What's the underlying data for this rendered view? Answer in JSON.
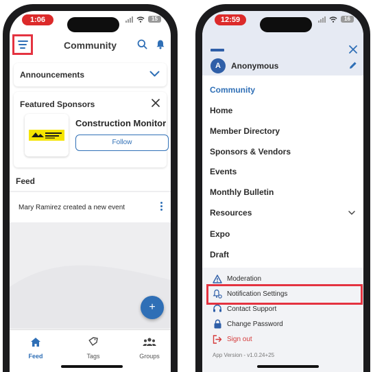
{
  "left_phone": {
    "status": {
      "time": "1:06",
      "battery": "15"
    },
    "header": {
      "title": "Community"
    },
    "announcements": {
      "label": "Announcements"
    },
    "featured_sponsors": {
      "label": "Featured Sponsors",
      "sponsor_name": "Construction Monitor",
      "logo_text": "CONSTRUCTION MONITOR",
      "follow_label": "Follow"
    },
    "feed": {
      "label": "Feed",
      "items": [
        {
          "text": "Mary Ramirez created a new event"
        }
      ]
    },
    "fab_label": "+",
    "tabs": [
      {
        "label": "Feed",
        "icon": "home-icon",
        "active": true
      },
      {
        "label": "Tags",
        "icon": "tag-icon",
        "active": false
      },
      {
        "label": "Groups",
        "icon": "groups-icon",
        "active": false
      }
    ]
  },
  "right_phone": {
    "status": {
      "time": "12:59",
      "battery": "16"
    },
    "user": {
      "initial": "A",
      "name": "Anonymous"
    },
    "nav": [
      {
        "label": "Community",
        "active": true
      },
      {
        "label": "Home"
      },
      {
        "label": "Member Directory"
      },
      {
        "label": "Sponsors & Vendors"
      },
      {
        "label": "Events"
      },
      {
        "label": "Monthly Bulletin"
      },
      {
        "label": "Resources",
        "has_chevron": true
      },
      {
        "label": "Expo"
      },
      {
        "label": "Draft"
      }
    ],
    "panel": [
      {
        "label": "Moderation",
        "icon": "warning-icon"
      },
      {
        "label": "Notification Settings",
        "icon": "bell-settings-icon",
        "highlighted": true
      },
      {
        "label": "Contact Support",
        "icon": "headset-icon"
      },
      {
        "label": "Change Password",
        "icon": "lock-icon"
      },
      {
        "label": "Sign out",
        "icon": "signout-icon"
      }
    ],
    "version": "App Version - v1.0.24+25"
  },
  "colors": {
    "primary": "#2f6fb6",
    "highlight": "#e43340",
    "signout": "#d53a3a",
    "status_pill": "#dc2a2a"
  }
}
